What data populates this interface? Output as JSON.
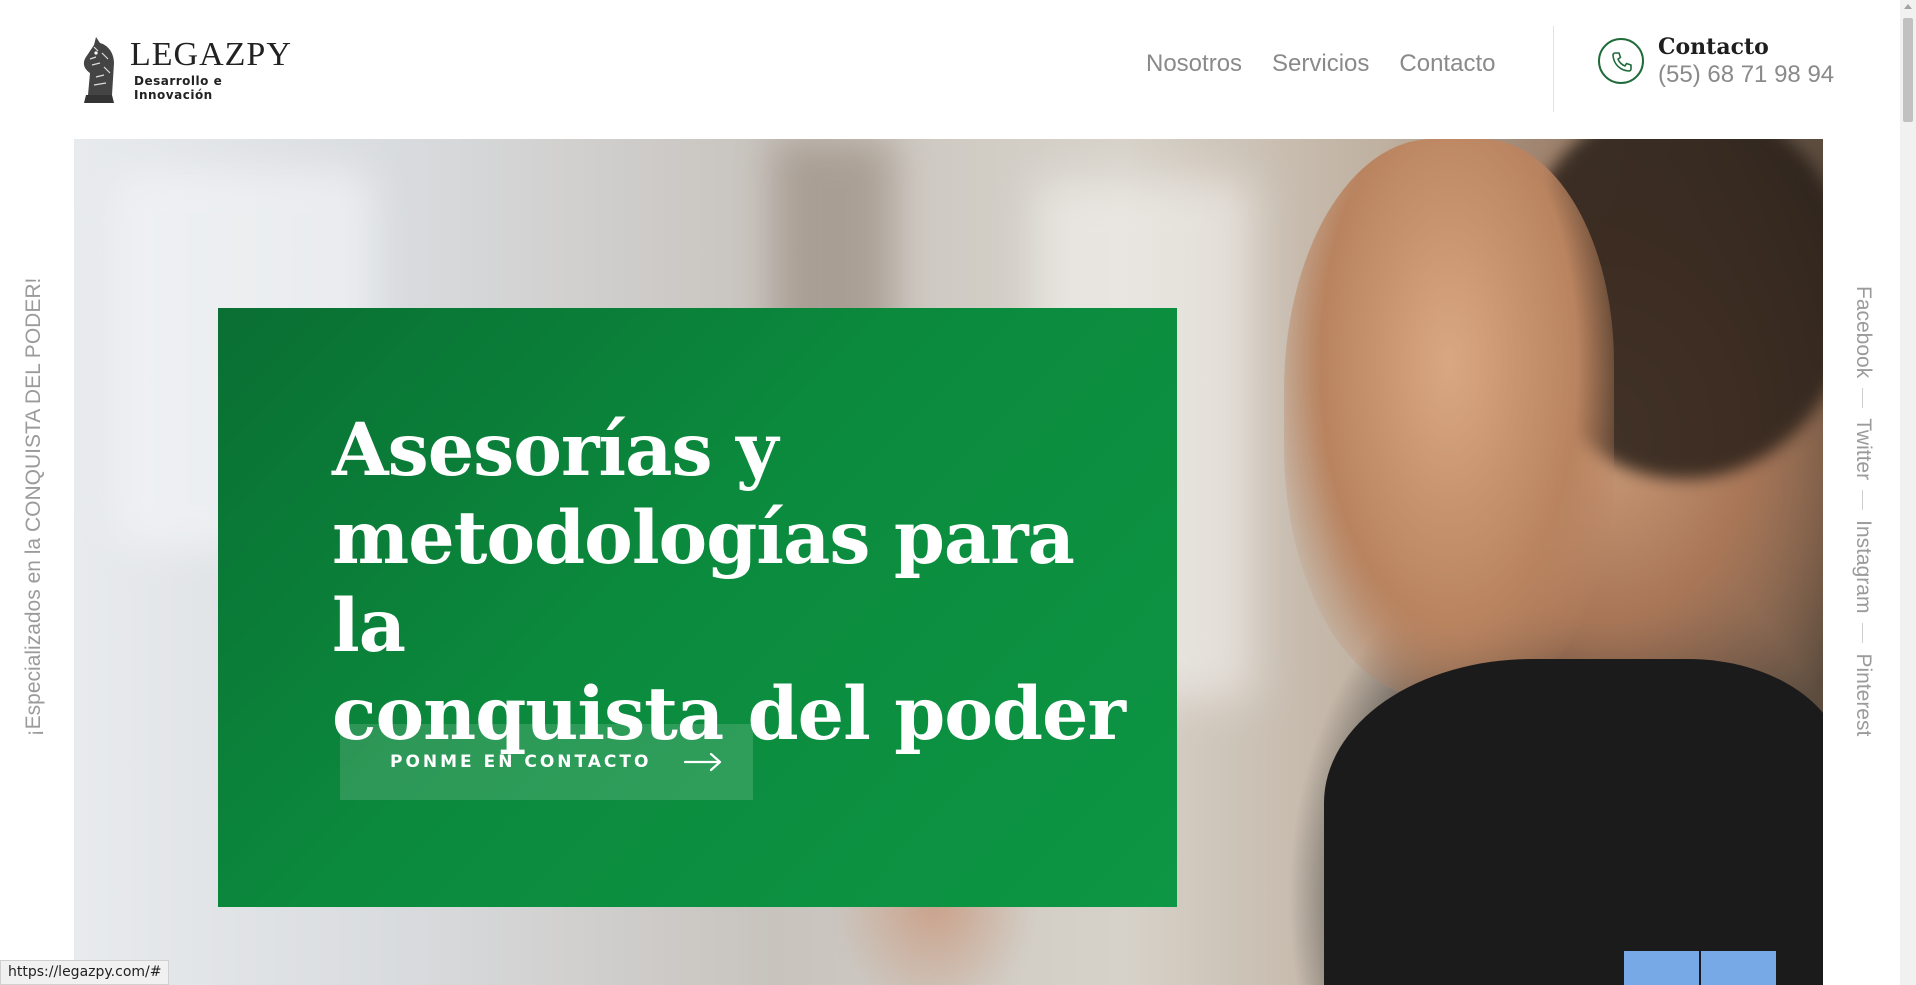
{
  "logo": {
    "name": "LEGAZPY",
    "tagline": "Desarrollo e Innovación",
    "icon": "chess-knight-icon"
  },
  "nav": {
    "items": [
      {
        "label": "Nosotros"
      },
      {
        "label": "Servicios"
      },
      {
        "label": "Contacto"
      }
    ]
  },
  "contact": {
    "title": "Contacto",
    "phone": "(55) 68 71 98 94",
    "icon": "phone-icon"
  },
  "side_left": {
    "text": "¡Especializados en la CONQUISTA DEL PODER!"
  },
  "social": {
    "items": [
      {
        "label": "Facebook"
      },
      {
        "label": "Twitter"
      },
      {
        "label": "Instagram"
      },
      {
        "label": "Pinterest"
      }
    ]
  },
  "hero": {
    "headline_line1": "Asesorías y",
    "headline_line2": "metodologías para la",
    "headline_line3": "conquista del poder",
    "cta_label": "PONME EN CONTACTO",
    "cta_icon": "arrow-right-icon"
  },
  "status_bar": {
    "url": "https://legazpy.com/#"
  },
  "colors": {
    "brand_green": "#0b8a3d",
    "nav_text": "#8a8a8a",
    "slider_blue": "#77a9e6"
  }
}
